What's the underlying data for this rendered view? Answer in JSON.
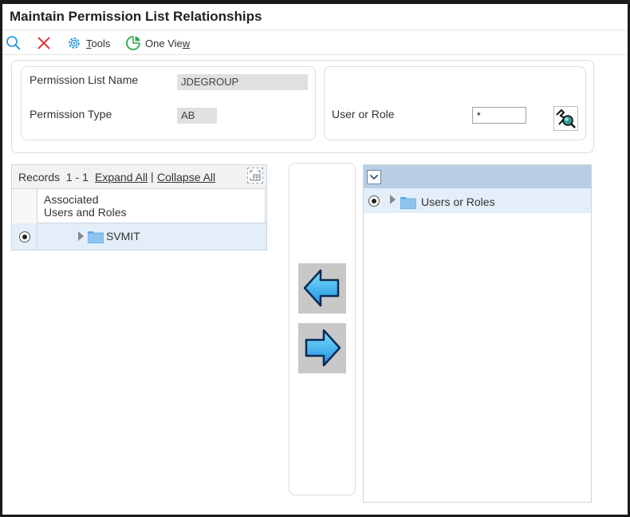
{
  "window": {
    "title": "Maintain Permission List Relationships"
  },
  "toolbar": {
    "tools_label": "Tools",
    "tools_mnemonic": "T",
    "tools_rest": "ools",
    "oneview_label": "One View",
    "oneview_prefix": "One Vie",
    "oneview_mnemonic": "w"
  },
  "form": {
    "permission_list_name_label": "Permission List Name",
    "permission_list_name_value": "JDEGROUP",
    "permission_type_label": "Permission Type",
    "permission_type_value": "AB",
    "user_or_role_label": "User or Role",
    "user_or_role_value": "*"
  },
  "left_grid": {
    "records_label": "Records",
    "records_range": "1 - 1",
    "expand_all": "Expand All",
    "separator": "|",
    "collapse_all": "Collapse All",
    "column_header_line1": "Associated",
    "column_header_line2": "Users and Roles",
    "rows": [
      {
        "label": "SVMIT",
        "selected": true
      }
    ]
  },
  "right_tree": {
    "rows": [
      {
        "label": "Users or Roles",
        "selected": true
      }
    ]
  },
  "colors": {
    "accent_blue": "#1a8fd6",
    "close_red": "#e0393e",
    "row_highlight": "#e3eef9",
    "header_blue": "#b9cde4",
    "arrow_button_bg": "#c8c8c8"
  },
  "icons": [
    "search-icon",
    "close-icon",
    "gear-icon",
    "one-view-icon",
    "expand-grid-icon",
    "folder-icon",
    "triangle-right-icon",
    "chevron-down-icon",
    "arrow-left-icon",
    "arrow-right-icon",
    "visual-assist-icon"
  ]
}
